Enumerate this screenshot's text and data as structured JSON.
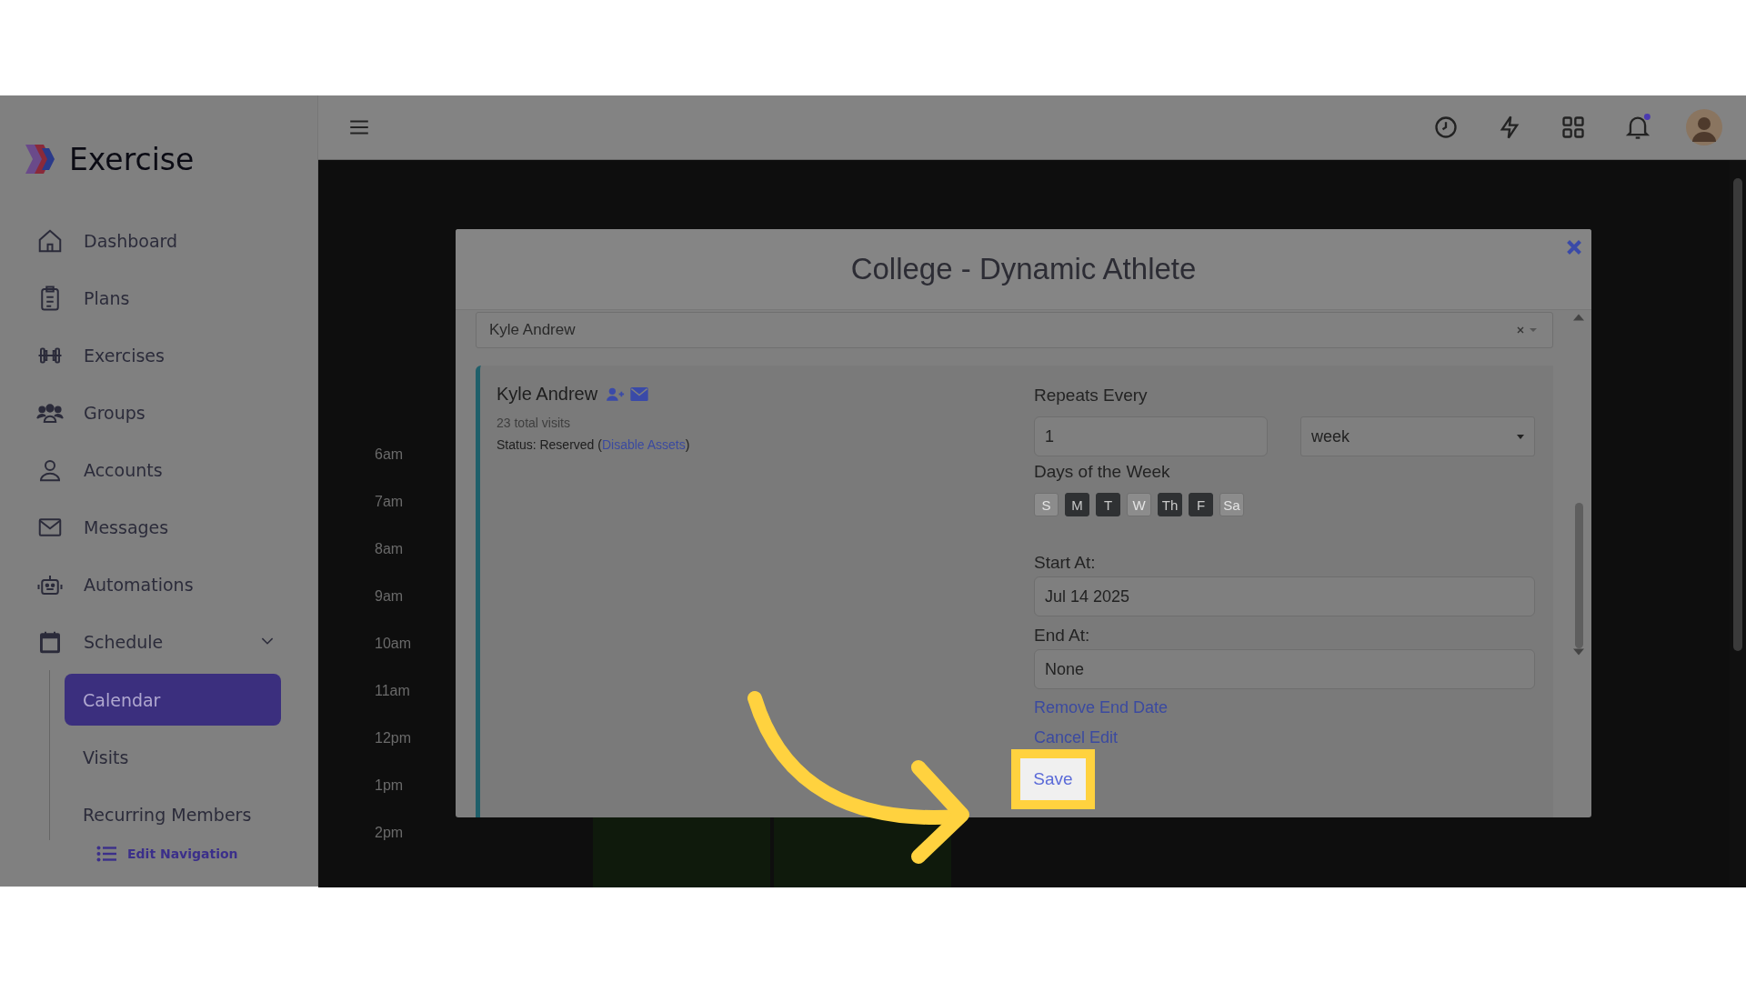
{
  "brand": {
    "name": "Exercise"
  },
  "sidebar": {
    "items": [
      {
        "label": "Dashboard",
        "kind": "home"
      },
      {
        "label": "Plans",
        "kind": "clipboard"
      },
      {
        "label": "Exercises",
        "kind": "dumbbell"
      },
      {
        "label": "Groups",
        "kind": "group"
      },
      {
        "label": "Accounts",
        "kind": "person"
      },
      {
        "label": "Messages",
        "kind": "mail"
      },
      {
        "label": "Automations",
        "kind": "robot"
      },
      {
        "label": "Schedule",
        "kind": "calendar",
        "expanded": true,
        "children": [
          {
            "label": "Calendar",
            "selected": true
          },
          {
            "label": "Visits",
            "selected": false
          },
          {
            "label": "Recurring Members",
            "selected": false
          }
        ]
      }
    ],
    "edit_navigation": "Edit Navigation"
  },
  "topbar": {
    "notifications": {
      "unread": true
    }
  },
  "calendar": {
    "time_labels": [
      "6am",
      "7am",
      "8am",
      "9am",
      "10am",
      "11am",
      "12pm",
      "1pm",
      "2pm"
    ]
  },
  "modal": {
    "title": "College - Dynamic Athlete",
    "member_select": {
      "value": "Kyle Andrew"
    },
    "member": {
      "name": "Kyle Andrew",
      "visits": "23 total visits",
      "status_prefix": "Status: Reserved (",
      "status_link": "Disable Assets",
      "status_suffix": ")"
    },
    "repeats_label": "Repeats Every",
    "repeat_count": "1",
    "repeat_unit": "week",
    "days_label": "Days of the Week",
    "days": [
      {
        "label": "S",
        "selected": false
      },
      {
        "label": "M",
        "selected": true
      },
      {
        "label": "T",
        "selected": true
      },
      {
        "label": "W",
        "selected": false
      },
      {
        "label": "Th",
        "selected": true
      },
      {
        "label": "F",
        "selected": true
      },
      {
        "label": "Sa",
        "selected": false
      }
    ],
    "start_label": "Start At:",
    "start_value": "Jul 14 2025",
    "end_label": "End At:",
    "end_value": "None",
    "remove_end": "Remove End Date",
    "cancel_edit": "Cancel Edit",
    "save": "Save"
  }
}
